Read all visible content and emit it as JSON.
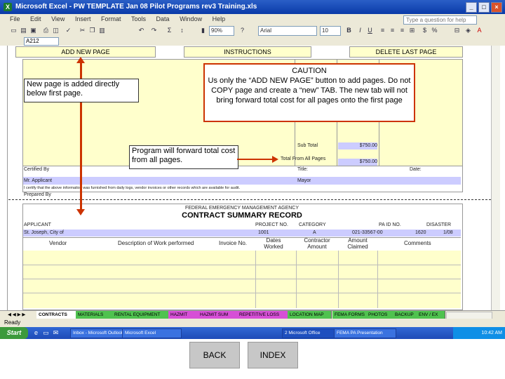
{
  "window": {
    "title": "Microsoft Excel - PW TEMPLATE Jan 08 Pilot Programs rev3 Training.xls",
    "help_placeholder": "Type a question for help"
  },
  "menu": [
    "File",
    "Edit",
    "View",
    "Insert",
    "Format",
    "Tools",
    "Data",
    "Window",
    "Help"
  ],
  "toolbar": {
    "zoom": "90%",
    "font": "Arial",
    "font_size": "10"
  },
  "formula_bar": {
    "name_box": "A212"
  },
  "sheet_buttons": {
    "add_new_page": "ADD NEW PAGE",
    "instructions": "INSTRUCTIONS",
    "delete_last_page": "DELETE LAST PAGE"
  },
  "annotations": {
    "new_page": "New page is added directly below first page.",
    "caution_title": "CAUTION",
    "caution_body": "Us only the “ADD NEW PAGE” button to add pages. Do not COPY page and create a “new” TAB.  The new tab will not bring forward total cost for all pages onto the first page",
    "forward": "Program will forward total cost from all pages."
  },
  "page1": {
    "sub_total_label": "Sub Total",
    "sub_total_value": "$750.00",
    "total_label": "Total From All Pages",
    "total_value": "$750.00",
    "certified_by": "Certified By",
    "title_label": "Title:",
    "date_label": "Date:",
    "signer": "Mr. Applicant",
    "signer_title": "Mayor",
    "cert_text": "I certify that the above information was furnished from daily logs, vendor invoices or other records which are available for audit.",
    "prepared_by": "Prepared By"
  },
  "page2": {
    "agency": "FEDERAL EMERGENCY MANAGEMENT AGENCY",
    "record_title": "CONTRACT SUMMARY RECORD",
    "headers": [
      "APPLICANT",
      "PROJECT NO.",
      "CATEGORY",
      "PA ID NO.",
      "DISASTER"
    ],
    "values": [
      "St. Joseph, City of",
      "1001",
      "A",
      "021-33567-00",
      "1620"
    ],
    "disaster_date": "1/08",
    "columns": [
      "Vendor",
      "Description of Work performed",
      "Invoice No.",
      "Dates Worked",
      "Contractor Amount",
      "Amount Claimed",
      "Comments"
    ]
  },
  "sheet_tabs": [
    "CONTRACTS",
    "MATERIALS",
    "RENTAL EQUIPMENT",
    "HAZMIT",
    "HAZMIT SUM",
    "REPETITIVE LOSS",
    "LOCATION MAP",
    "FEMA FORMS",
    "PHOTOS",
    "BACKUP",
    "ENV / EX"
  ],
  "status": "Ready",
  "taskbar": {
    "start": "Start",
    "tasks": [
      "Inbox - Microsoft Outlook",
      "Microsoft Excel",
      "2 Microsoft Office",
      "FEMA PA Presentation"
    ],
    "clock": "10:42 AM"
  },
  "nav": {
    "back": "BACK",
    "index": "INDEX"
  },
  "colors": {
    "caution_border": "#cc3300",
    "sheet_yellow": "#ffffcc",
    "sheet_lavender": "#ccccff"
  }
}
